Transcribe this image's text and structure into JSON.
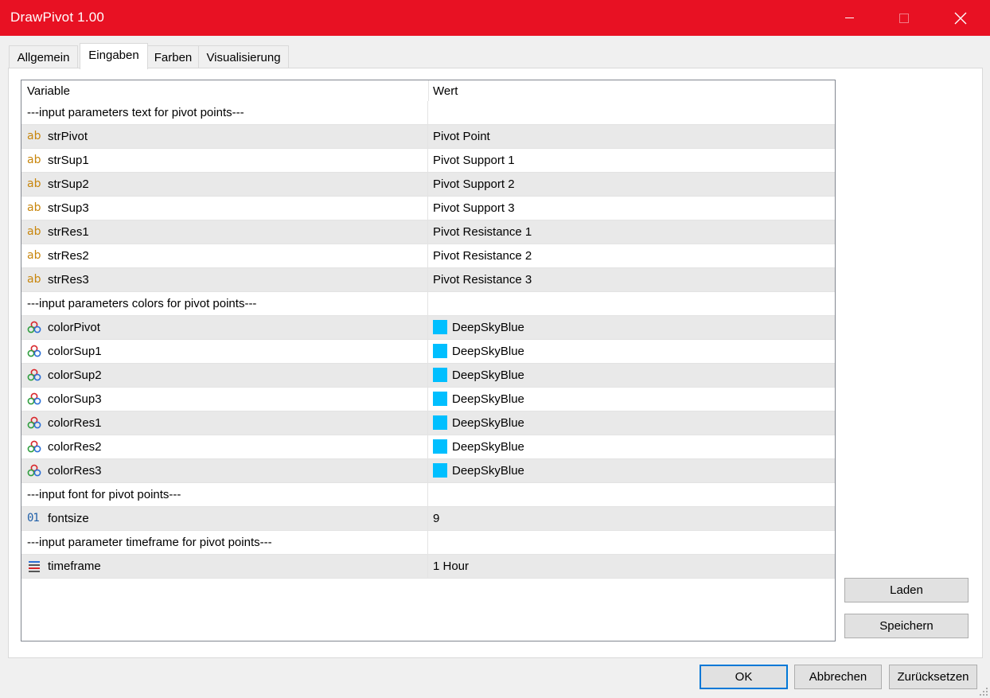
{
  "window": {
    "title": "DrawPivot 1.00",
    "close_glyph": "✕"
  },
  "tabs": [
    {
      "label": "Allgemein",
      "active": false
    },
    {
      "label": "Eingaben",
      "active": true
    },
    {
      "label": "Farben",
      "active": false
    },
    {
      "label": "Visualisierung",
      "active": false
    }
  ],
  "grid": {
    "columns": [
      "Variable",
      "Wert"
    ],
    "rows": [
      {
        "type": "section",
        "label": "---input parameters text for pivot points---"
      },
      {
        "type": "string",
        "icon": "ab",
        "name": "strPivot",
        "value": "Pivot Point"
      },
      {
        "type": "string",
        "icon": "ab",
        "name": "strSup1",
        "value": "Pivot Support 1"
      },
      {
        "type": "string",
        "icon": "ab",
        "name": "strSup2",
        "value": "Pivot Support 2"
      },
      {
        "type": "string",
        "icon": "ab",
        "name": "strSup3",
        "value": "Pivot Support 3"
      },
      {
        "type": "string",
        "icon": "ab",
        "name": "strRes1",
        "value": "Pivot Resistance 1"
      },
      {
        "type": "string",
        "icon": "ab",
        "name": "strRes2",
        "value": "Pivot Resistance 2"
      },
      {
        "type": "string",
        "icon": "ab",
        "name": "strRes3",
        "value": "Pivot Resistance 3"
      },
      {
        "type": "section",
        "label": "---input parameters colors for pivot points---"
      },
      {
        "type": "color",
        "name": "colorPivot",
        "value": "DeepSkyBlue",
        "swatch": "#00bfff"
      },
      {
        "type": "color",
        "name": "colorSup1",
        "value": "DeepSkyBlue",
        "swatch": "#00bfff"
      },
      {
        "type": "color",
        "name": "colorSup2",
        "value": "DeepSkyBlue",
        "swatch": "#00bfff"
      },
      {
        "type": "color",
        "name": "colorSup3",
        "value": "DeepSkyBlue",
        "swatch": "#00bfff"
      },
      {
        "type": "color",
        "name": "colorRes1",
        "value": "DeepSkyBlue",
        "swatch": "#00bfff"
      },
      {
        "type": "color",
        "name": "colorRes2",
        "value": "DeepSkyBlue",
        "swatch": "#00bfff"
      },
      {
        "type": "color",
        "name": "colorRes3",
        "value": "DeepSkyBlue",
        "swatch": "#00bfff"
      },
      {
        "type": "section",
        "label": "---input font for pivot points---"
      },
      {
        "type": "int",
        "icon": "01",
        "name": "fontsize",
        "value": "9"
      },
      {
        "type": "section",
        "label": "---input parameter timeframe for pivot points---"
      },
      {
        "type": "enum",
        "name": "timeframe",
        "value": "1 Hour"
      }
    ]
  },
  "side_buttons": {
    "load": "Laden",
    "save": "Speichern"
  },
  "footer_buttons": {
    "ok": "OK",
    "cancel": "Abbrechen",
    "reset": "Zurücksetzen"
  },
  "colors": {
    "titlebar": "#e81123",
    "deep_sky_blue": "#00bfff",
    "focus_border": "#0078d7"
  }
}
